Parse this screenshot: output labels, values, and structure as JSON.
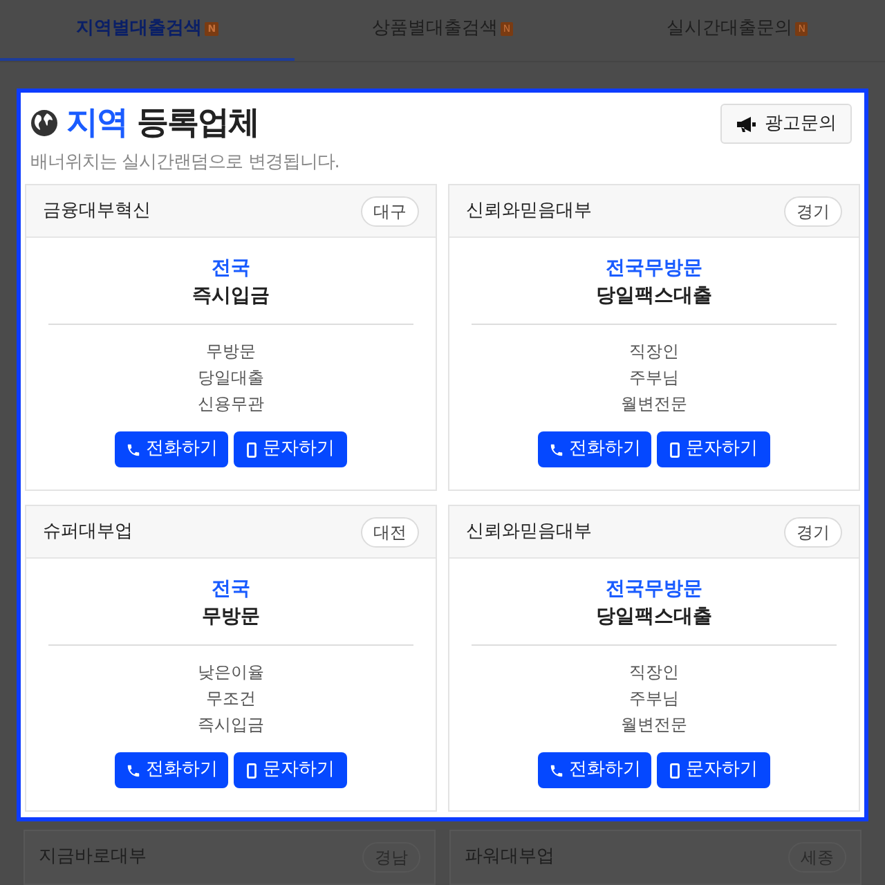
{
  "tabs": [
    {
      "label": "지역별대출검색",
      "badge": "N",
      "selected": true
    },
    {
      "label": "상품별대출검색",
      "badge": "N",
      "selected": false
    },
    {
      "label": "실시간대출문의",
      "badge": "N",
      "selected": false
    }
  ],
  "featured": {
    "title_highlight": "지역",
    "title": "등록업체",
    "subtitle": "배너위치는 실시간랜덤으로 변경됩니다.",
    "ad_button": "광고문의",
    "cards": [
      {
        "name": "금융대부혁신",
        "region": "대구",
        "area": "전국",
        "headline": "즉시입금",
        "features": [
          "무방문",
          "당일대출",
          "신용무관"
        ],
        "call_button": "전화하기",
        "sms_button": "문자하기"
      },
      {
        "name": "신뢰와믿음대부",
        "region": "경기",
        "area": "전국무방문",
        "headline": "당일팩스대출",
        "features": [
          "직장인",
          "주부님",
          "월변전문"
        ],
        "call_button": "전화하기",
        "sms_button": "문자하기"
      },
      {
        "name": "슈퍼대부업",
        "region": "대전",
        "area": "전국",
        "headline": "무방문",
        "features": [
          "낮은이율",
          "무조건",
          "즉시입금"
        ],
        "call_button": "전화하기",
        "sms_button": "문자하기"
      },
      {
        "name": "신뢰와믿음대부",
        "region": "경기",
        "area": "전국무방문",
        "headline": "당일팩스대출",
        "features": [
          "직장인",
          "주부님",
          "월변전문"
        ],
        "call_button": "전화하기",
        "sms_button": "문자하기"
      }
    ]
  },
  "dimmed_cards": [
    {
      "name": "지금바로대부",
      "region": "경남"
    },
    {
      "name": "파워대부업",
      "region": "세종"
    }
  ]
}
